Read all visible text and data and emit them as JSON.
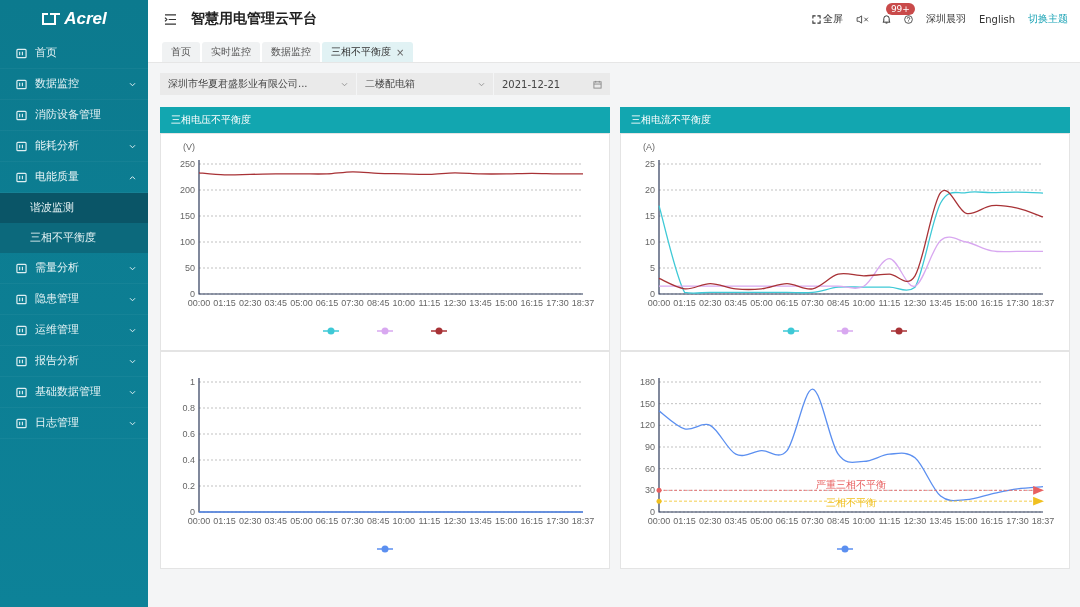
{
  "sidebar": {
    "logo": "Acrel",
    "items": [
      {
        "label": "首页"
      },
      {
        "label": "数据监控",
        "expanded": false
      },
      {
        "label": "消防设备管理"
      },
      {
        "label": "能耗分析",
        "expanded": false
      },
      {
        "label": "电能质量",
        "expanded": true,
        "children": [
          {
            "label": "谐波监测",
            "selected": false
          },
          {
            "label": "三相不平衡度",
            "selected": true
          }
        ]
      },
      {
        "label": "需量分析",
        "expanded": false
      },
      {
        "label": "隐患管理",
        "expanded": false
      },
      {
        "label": "运维管理",
        "expanded": false
      },
      {
        "label": "报告分析",
        "expanded": false
      },
      {
        "label": "基础数据管理",
        "expanded": false
      },
      {
        "label": "日志管理",
        "expanded": false
      }
    ]
  },
  "header": {
    "title": "智慧用电管理云平台",
    "fullscreen": "全屏",
    "badge": "99+",
    "user": "深圳晨羽",
    "language": "English",
    "theme": "切换主题"
  },
  "tabs": [
    {
      "label": "首页",
      "selected": false
    },
    {
      "label": "实时监控",
      "selected": false
    },
    {
      "label": "数据监控",
      "selected": false
    },
    {
      "label": "三相不平衡度",
      "selected": true,
      "close": "×"
    }
  ],
  "filters": {
    "company": "深圳市华夏君盛影业有限公司...",
    "device": "二楼配电箱",
    "date": "2021-12-21"
  },
  "panels": [
    {
      "title": "三相电压不平衡度",
      "charts": [
        {
          "chart_data": {
            "type": "line",
            "ylabel": "(V)",
            "categories": [
              "00:00",
              "01:15",
              "02:30",
              "03:45",
              "05:00",
              "06:15",
              "07:30",
              "08:45",
              "10:00",
              "11:15",
              "12:30",
              "13:45",
              "15:00",
              "16:15",
              "17:30",
              "18:37"
            ],
            "ylim": [
              0,
              250
            ],
            "grid": true,
            "yticks": [
              0,
              50,
              100,
              150,
              200,
              250
            ],
            "series": [
              {
                "color": "#3ec9d6",
                "values": [
                  null,
                  null,
                  null,
                  null,
                  null,
                  null,
                  null,
                  null,
                  null,
                  null,
                  null,
                  null,
                  null,
                  null,
                  null,
                  null
                ]
              },
              {
                "color": "#d8a8f0",
                "values": [
                  null,
                  null,
                  null,
                  null,
                  null,
                  null,
                  null,
                  null,
                  null,
                  null,
                  null,
                  null,
                  null,
                  null,
                  null,
                  null
                ]
              },
              {
                "color": "#a83236",
                "values": [
                  233,
                  229,
                  230,
                  231,
                  231,
                  231,
                  235,
                  232,
                  231,
                  230,
                  233,
                  231,
                  231,
                  232,
                  231,
                  231
                ]
              }
            ]
          }
        },
        {
          "chart_data": {
            "type": "line",
            "categories": [
              "00:00",
              "01:15",
              "02:30",
              "03:45",
              "05:00",
              "06:15",
              "07:30",
              "08:45",
              "10:00",
              "11:15",
              "12:30",
              "13:45",
              "15:00",
              "16:15",
              "17:30",
              "18:37"
            ],
            "ylim": [
              0,
              1
            ],
            "grid": true,
            "yticks": [
              0,
              0.2,
              0.4,
              0.6,
              0.8,
              1
            ],
            "series": [
              {
                "color": "#5b8ff0",
                "values": [
                  0,
                  0,
                  0,
                  0,
                  0,
                  0,
                  0,
                  0,
                  0,
                  0,
                  0,
                  0,
                  0,
                  0,
                  0,
                  0
                ]
              }
            ]
          }
        }
      ]
    },
    {
      "title": "三相电流不平衡度",
      "charts": [
        {
          "chart_data": {
            "type": "line",
            "ylabel": "(A)",
            "categories": [
              "00:00",
              "01:15",
              "02:30",
              "03:45",
              "05:00",
              "06:15",
              "07:30",
              "08:45",
              "10:00",
              "11:15",
              "12:30",
              "13:45",
              "15:00",
              "16:15",
              "17:30",
              "18:37"
            ],
            "ylim": [
              0,
              25
            ],
            "grid": true,
            "yticks": [
              0,
              5,
              10,
              15,
              20,
              25
            ],
            "series": [
              {
                "color": "#3ec9d6",
                "values": [
                  17,
                  0.3,
                  0.3,
                  0.3,
                  0.3,
                  0.3,
                  0.3,
                  1.3,
                  1.3,
                  1.3,
                  1.3,
                  17.5,
                  19.5,
                  19.5,
                  19.6,
                  19.4
                ]
              },
              {
                "color": "#d8a8f0",
                "values": [
                  1.5,
                  1.5,
                  1.5,
                  1.5,
                  1.5,
                  1.5,
                  1.5,
                  1.5,
                  1.5,
                  6.8,
                  1.5,
                  10.3,
                  10,
                  8.3,
                  8.2,
                  8.2
                ]
              },
              {
                "color": "#a83236",
                "values": [
                  3,
                  1,
                  2,
                  1,
                  1,
                  2,
                  1,
                  3.8,
                  3.5,
                  3.8,
                  3.5,
                  19.5,
                  15.5,
                  17,
                  16.5,
                  14.8
                ]
              }
            ]
          }
        },
        {
          "chart_data": {
            "type": "line",
            "categories": [
              "00:00",
              "01:15",
              "02:30",
              "03:45",
              "05:00",
              "06:15",
              "07:30",
              "08:45",
              "10:00",
              "11:15",
              "12:30",
              "13:45",
              "15:00",
              "16:15",
              "17:30",
              "18:37"
            ],
            "ylim": [
              0,
              180
            ],
            "yticks": [
              0,
              30,
              60,
              90,
              120,
              150,
              180
            ],
            "series": [
              {
                "color": "#5b8ff0",
                "values": [
                  140,
                  115,
                  120,
                  80,
                  85,
                  85,
                  170,
                  80,
                  70,
                  80,
                  75,
                  22,
                  17,
                  25,
                  32,
                  35
                ]
              }
            ],
            "grid": true,
            "ref_lines": [
              {
                "axis": "y",
                "value": 30,
                "label": "严重三相不平衡",
                "color": "#e86060"
              },
              {
                "axis": "y",
                "value": 15,
                "label": "三相不平衡",
                "color": "#f0c020"
              }
            ]
          }
        }
      ]
    }
  ]
}
